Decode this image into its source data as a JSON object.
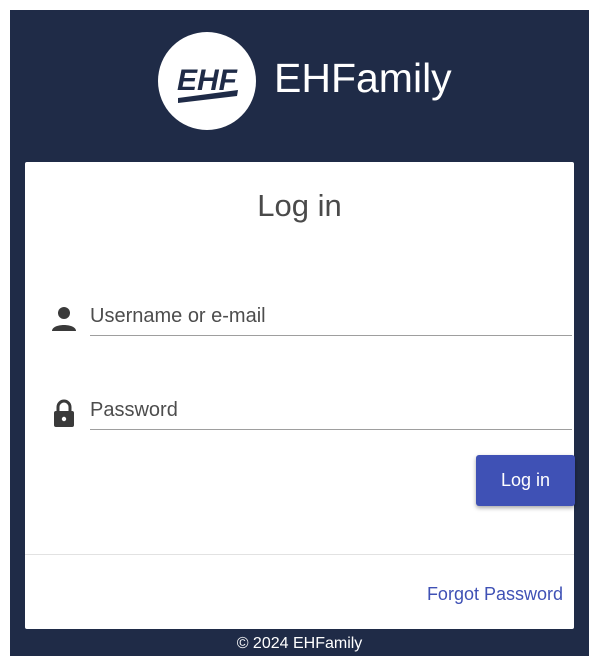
{
  "brand": {
    "logo_text": "EHF",
    "name": "EHFamily"
  },
  "login": {
    "title": "Log in",
    "username": {
      "placeholder": "Username or e-mail",
      "value": "",
      "icon": "person-icon"
    },
    "password": {
      "placeholder": "Password",
      "value": "",
      "icon": "lock-icon"
    },
    "submit_label": "Log in",
    "forgot_label": "Forgot Password"
  },
  "footer": {
    "copyright": "© 2024 EHFamily"
  },
  "colors": {
    "header_background": "#1f2b47",
    "accent": "#3f51b5",
    "card_background": "#ffffff"
  }
}
